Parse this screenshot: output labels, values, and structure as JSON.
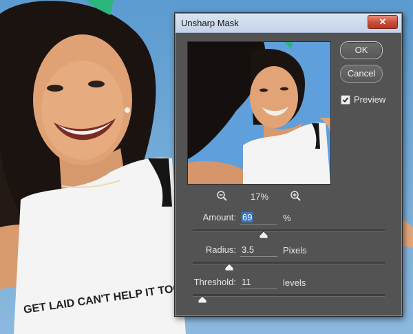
{
  "dialog": {
    "title": "Unsharp Mask",
    "close_glyph": "✕",
    "ok_label": "OK",
    "cancel_label": "Cancel",
    "preview_label": "Preview",
    "preview_checked": true,
    "zoom_level": "17%",
    "params": [
      {
        "label": "Amount:",
        "value": "69",
        "unit": "%",
        "slider_fraction": 0.37
      },
      {
        "label": "Radius:",
        "value": "3.5",
        "unit": "Pixels",
        "slider_fraction": 0.19
      },
      {
        "label": "Threshold:",
        "value": "11",
        "unit": "levels",
        "slider_fraction": 0.05
      }
    ]
  },
  "photo": {
    "shirt_print_text": "GET LAID CAN'T HELP IT TOO DIMORIE"
  },
  "icons": [
    "zoom-out-icon",
    "zoom-in-icon",
    "checkmark-icon",
    "close-icon",
    "slider-thumb-icon"
  ],
  "colors": {
    "dialog_bg": "#535353",
    "titlebar": "#c9d7ea",
    "close_button": "#c74b37",
    "selection": "#3a78c4",
    "sky": "#6aa2d0"
  }
}
